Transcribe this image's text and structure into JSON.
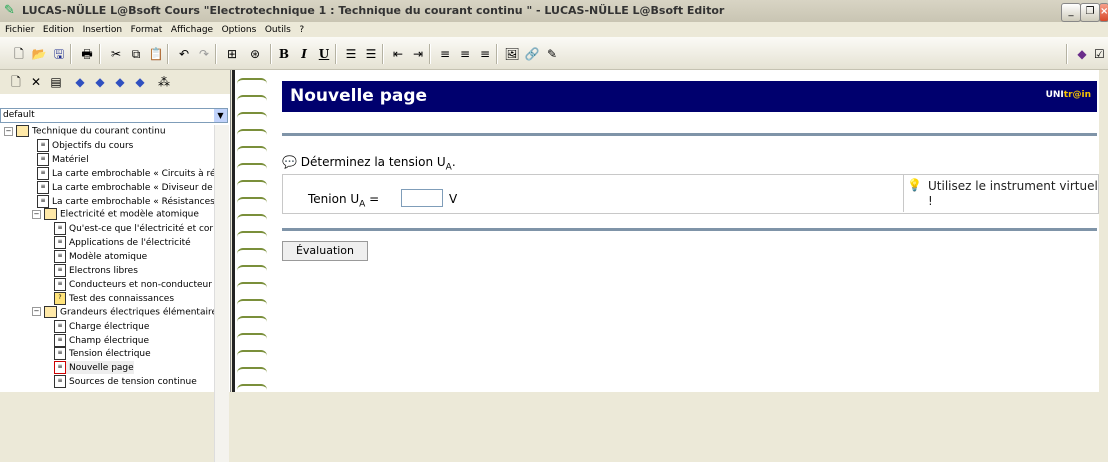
{
  "window": {
    "title": "LUCAS-NÜLLE L@Bsoft Cours \"Electrotechnique 1 : Technique du courant continu \" - LUCAS-NÜLLE L@Bsoft Editor",
    "buttons": [
      "minimize-icon",
      "restore-icon",
      "close-icon"
    ]
  },
  "menu": [
    "Fichier",
    "Edition",
    "Insertion",
    "Format",
    "Affichage",
    "Options",
    "Outils",
    "?"
  ],
  "toolbar": {
    "icons": [
      "new-icon",
      "open-icon",
      "save-icon",
      "print-icon",
      "cut-icon",
      "copy-icon",
      "paste-icon",
      "undo-icon",
      "redo-icon",
      "numbering-icon",
      "symbol-icon",
      "bold-icon",
      "italic-icon",
      "underline-icon",
      "bullet-list-icon",
      "numbered-list-icon",
      "indent-decrease-icon",
      "indent-increase-icon",
      "align-left-icon",
      "align-center-icon",
      "align-right-icon",
      "image-icon",
      "link-icon",
      "edit-icon",
      "book-icon"
    ],
    "labels": {
      "bold": "B",
      "italic": "I",
      "underline": "U"
    }
  },
  "sidebar": {
    "dropdown_value": "default",
    "tree": [
      {
        "label": "Technique du courant continu",
        "level": 0,
        "type": "book",
        "expanded": true
      },
      {
        "label": "Objectifs du cours",
        "level": 1,
        "type": "page"
      },
      {
        "label": "Matériel",
        "level": 1,
        "type": "page"
      },
      {
        "label": "La carte embrochable « Circuits à ré",
        "level": 1,
        "type": "page"
      },
      {
        "label": "La carte embrochable « Diviseur de",
        "level": 1,
        "type": "page"
      },
      {
        "label": "La carte embrochable « Résistances",
        "level": 1,
        "type": "page"
      },
      {
        "label": "Electricité et modèle atomique",
        "level": 1,
        "type": "book",
        "expanded": true
      },
      {
        "label": "Qu'est-ce que l'électricité et cor",
        "level": 2,
        "type": "page"
      },
      {
        "label": "Applications de l'électricité",
        "level": 2,
        "type": "page"
      },
      {
        "label": "Modèle atomique",
        "level": 2,
        "type": "page"
      },
      {
        "label": "Electrons libres",
        "level": 2,
        "type": "page"
      },
      {
        "label": "Conducteurs et non-conducteur",
        "level": 2,
        "type": "page"
      },
      {
        "label": "Test des connaissances",
        "level": 2,
        "type": "test"
      },
      {
        "label": "Grandeurs électriques élémentaires",
        "level": 1,
        "type": "book",
        "expanded": true
      },
      {
        "label": "Charge électrique",
        "level": 2,
        "type": "page"
      },
      {
        "label": "Champ électrique",
        "level": 2,
        "type": "page"
      },
      {
        "label": "Tension électrique",
        "level": 2,
        "type": "page"
      },
      {
        "label": "Nouvelle page",
        "level": 2,
        "type": "page",
        "selected": true
      },
      {
        "label": "Sources de tension continue",
        "level": 2,
        "type": "page"
      }
    ]
  },
  "main": {
    "header_title": "Nouvelle page",
    "logo_prefix": "UNI",
    "logo_highlight": "tr@in",
    "question_text": "Déterminez la tension U",
    "question_sub": "A",
    "question_suffix": ".",
    "answer_label": "Tenion U",
    "answer_sub": "A",
    "answer_equals": " =",
    "answer_value": "",
    "unit": "V",
    "hint_text": "Utilisez le instrument virtuel !",
    "button_label": "Évaluation"
  }
}
